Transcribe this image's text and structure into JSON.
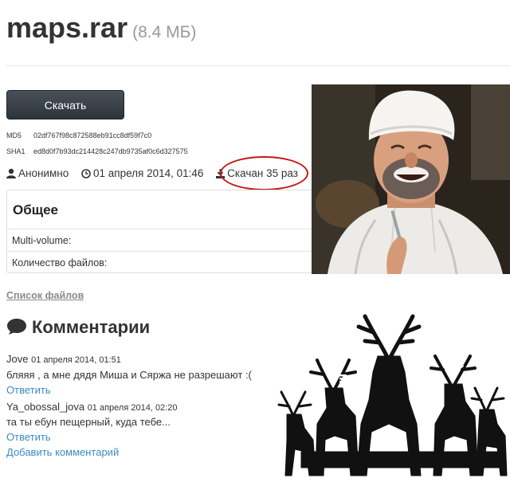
{
  "file": {
    "name": "maps.rar",
    "size": "(8.4 МБ)"
  },
  "download_button": "Скачать",
  "hashes": {
    "md5_label": "MD5",
    "md5": "02df767f98c872588eb91cc8df59f7c0",
    "sha1_label": "SHA1",
    "sha1": "ed8d0f7b93dc214428c247db9735af0c6d327575"
  },
  "meta": {
    "author": "Анонимно",
    "date": "01 апреля 2014, 01:46",
    "downloads": "Скачан 35 раз",
    "icons": [
      "user-icon",
      "clock-icon",
      "download-icon"
    ]
  },
  "general": {
    "heading": "Общее",
    "rows": [
      "Multi-volume:",
      "Количество файлов:"
    ]
  },
  "files_link": "Список файлов",
  "comments": {
    "heading": "Комментарии",
    "items": [
      {
        "author": "Jove",
        "date": "01 апреля 2014, 01:51",
        "text": "бляяя , а мне дядя Миша и Сяржа не разрешают :(",
        "reply": "Ответить"
      },
      {
        "author": "Ya_obossal_jova",
        "date": "01 апреля 2014, 02:20",
        "text": "та ты ебун пещерный, куда тебе...",
        "reply": "Ответить"
      }
    ],
    "add": "Добавить комментарий"
  },
  "colors": {
    "link": "#3a8bc2",
    "button": "#3b434b",
    "highlight": "#c01a1a"
  }
}
